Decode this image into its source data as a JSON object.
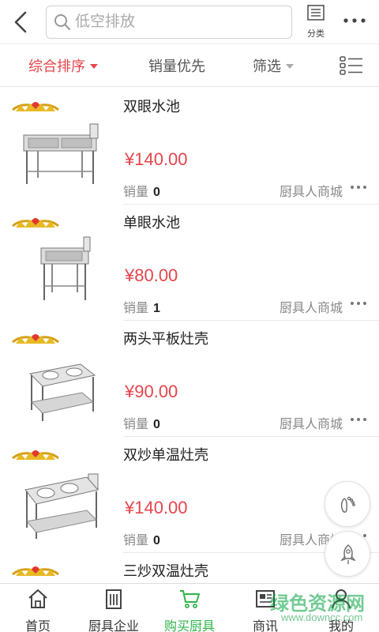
{
  "header": {
    "search_placeholder": "低空排放",
    "category_label": "分类"
  },
  "sortbar": {
    "items": [
      {
        "label": "综合排序"
      },
      {
        "label": "销量优先"
      },
      {
        "label": "筛选"
      }
    ]
  },
  "products": [
    {
      "title": "双眼水池",
      "price": "¥140.00",
      "sales_label": "销量",
      "sales": "0",
      "shop": "厨具人商城"
    },
    {
      "title": "单眼水池",
      "price": "¥80.00",
      "sales_label": "销量",
      "sales": "1",
      "shop": "厨具人商城"
    },
    {
      "title": "两头平板灶壳",
      "price": "¥90.00",
      "sales_label": "销量",
      "sales": "0",
      "shop": "厨具人商城"
    },
    {
      "title": "双炒单温灶壳",
      "price": "¥140.00",
      "sales_label": "销量",
      "sales": "0",
      "shop": "厨具人商城"
    },
    {
      "title": "三炒双温灶壳"
    }
  ],
  "nav": {
    "tabs": [
      {
        "label": "首页",
        "icon": "home-icon"
      },
      {
        "label": "厨具企业",
        "icon": "building-icon"
      },
      {
        "label": "购买厨具",
        "icon": "cart-icon"
      },
      {
        "label": "商讯",
        "icon": "news-icon"
      },
      {
        "label": "我的",
        "icon": "user-icon"
      }
    ]
  },
  "watermark": {
    "line1": "绿色资源网",
    "line2": "www.downcc.com"
  },
  "colors": {
    "accent_red": "#e5454b",
    "active_green": "#2fb34a"
  }
}
